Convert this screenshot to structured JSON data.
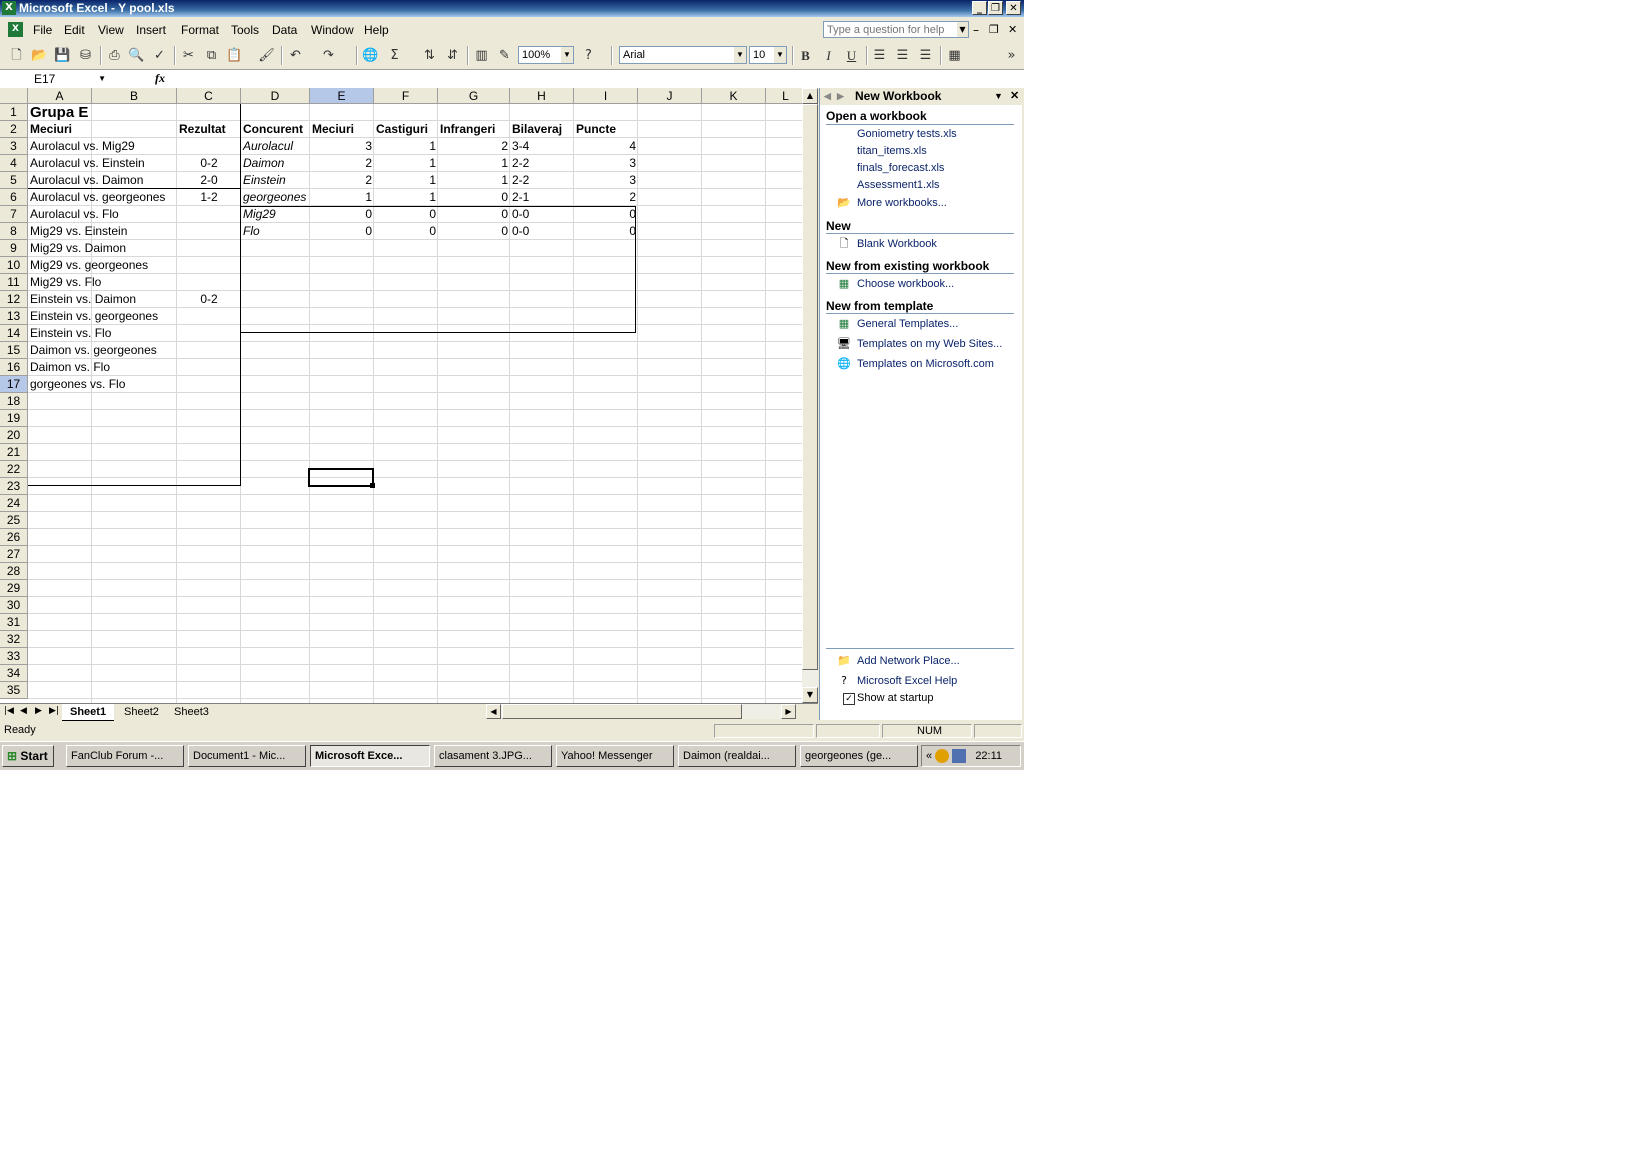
{
  "window": {
    "title": "Microsoft Excel - Y pool.xls"
  },
  "menu": [
    "File",
    "Edit",
    "View",
    "Insert",
    "Format",
    "Tools",
    "Data",
    "Window",
    "Help"
  ],
  "help_placeholder": "Type a question for help",
  "toolbar": {
    "zoom": "100%",
    "font": "Arial",
    "size": "10"
  },
  "formula_bar": {
    "name_box": "E17",
    "fx": "fx"
  },
  "columns": [
    "A",
    "B",
    "C",
    "D",
    "E",
    "F",
    "G",
    "H",
    "I",
    "J",
    "K",
    "L"
  ],
  "rows": [
    "1",
    "2",
    "3",
    "4",
    "5",
    "6",
    "7",
    "8",
    "9",
    "10",
    "11",
    "12",
    "13",
    "14",
    "15",
    "16",
    "17",
    "18",
    "19",
    "20",
    "21",
    "22",
    "23",
    "24",
    "25",
    "26",
    "27",
    "28",
    "29",
    "30",
    "31",
    "32",
    "33",
    "34",
    "35"
  ],
  "sheet": {
    "group_title": "Grupa E",
    "left_headers": {
      "matches": "Meciuri",
      "result": "Rezultat"
    },
    "matches": [
      {
        "m": "Aurolacul vs. Mig29",
        "r": ""
      },
      {
        "m": "Aurolacul vs. Einstein",
        "r": "0-2"
      },
      {
        "m": "Aurolacul vs. Daimon",
        "r": "2-0"
      },
      {
        "m": "Aurolacul vs. georgeones",
        "r": "1-2"
      },
      {
        "m": "Aurolacul vs. Flo",
        "r": ""
      },
      {
        "m": "Mig29 vs. Einstein",
        "r": ""
      },
      {
        "m": "Mig29 vs. Daimon",
        "r": ""
      },
      {
        "m": "Mig29 vs. georgeones",
        "r": ""
      },
      {
        "m": "Mig29 vs. Flo",
        "r": ""
      },
      {
        "m": "Einstein vs. Daimon",
        "r": "0-2"
      },
      {
        "m": "Einstein vs. georgeones",
        "r": ""
      },
      {
        "m": "Einstein vs. Flo",
        "r": ""
      },
      {
        "m": "Daimon vs. georgeones",
        "r": ""
      },
      {
        "m": "Daimon vs. Flo",
        "r": ""
      },
      {
        "m": "gorgeones vs. Flo",
        "r": ""
      }
    ],
    "standings_headers": [
      "Concurent",
      "Meciuri",
      "Castiguri",
      "Infrangeri",
      "Bilaveraj",
      "Puncte"
    ],
    "standings": [
      {
        "name": "Aurolacul",
        "played": "3",
        "won": "1",
        "lost": "2",
        "diff": "3-4",
        "pts": "4"
      },
      {
        "name": "Daimon",
        "played": "2",
        "won": "1",
        "lost": "1",
        "diff": "2-2",
        "pts": "3"
      },
      {
        "name": "Einstein",
        "played": "2",
        "won": "1",
        "lost": "1",
        "diff": "2-2",
        "pts": "3"
      },
      {
        "name": "georgeones",
        "played": "1",
        "won": "1",
        "lost": "0",
        "diff": "2-1",
        "pts": "2"
      },
      {
        "name": "Mig29",
        "played": "0",
        "won": "0",
        "lost": "0",
        "diff": "0-0",
        "pts": "0"
      },
      {
        "name": "Flo",
        "played": "0",
        "won": "0",
        "lost": "0",
        "diff": "0-0",
        "pts": "0"
      }
    ]
  },
  "sheet_tabs": [
    "Sheet1",
    "Sheet2",
    "Sheet3"
  ],
  "task_pane": {
    "title": "New Workbook",
    "open_title": "Open a workbook",
    "recent": [
      "Goniometry tests.xls",
      "titan_items.xls",
      "finals_forecast.xls",
      "Assessment1.xls"
    ],
    "more": "More workbooks...",
    "new_title": "New",
    "blank": "Blank Workbook",
    "existing_title": "New from existing workbook",
    "choose": "Choose workbook...",
    "template_title": "New from template",
    "templates": [
      "General Templates...",
      "Templates on my Web Sites...",
      "Templates on Microsoft.com"
    ],
    "add_network": "Add Network Place...",
    "excel_help": "Microsoft Excel Help",
    "show_startup": "Show at startup"
  },
  "status": {
    "ready": "Ready",
    "num": "NUM"
  },
  "taskbar": {
    "start": "Start",
    "items": [
      "FanClub Forum -...",
      "Document1 - Mic...",
      "Microsoft Exce...",
      "clasament 3.JPG...",
      "Yahoo! Messenger",
      "Daimon  (realdai...",
      "georgeones  (ge..."
    ],
    "chevron": "«",
    "clock": "22:11"
  }
}
